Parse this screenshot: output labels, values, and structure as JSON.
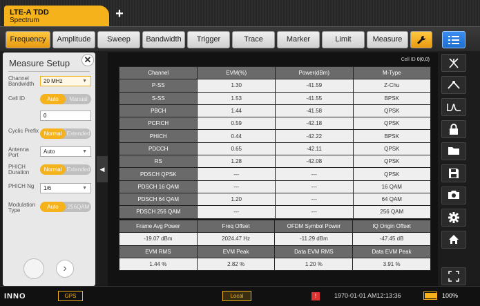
{
  "window": {
    "mode_tab": {
      "title": "LTE-A TDD",
      "subtitle": "Spectrum"
    },
    "add_tab_glyph": "+"
  },
  "menubar": {
    "items": [
      "Frequency",
      "Amplitude",
      "Sweep",
      "Bandwidth",
      "Trigger",
      "Trace",
      "Marker",
      "Limit",
      "Measure"
    ],
    "selected": "Frequency"
  },
  "panel": {
    "title": "Measure Setup",
    "close_glyph": "✕",
    "fields": {
      "channel_bandwidth": {
        "label": "Channel Bandwidth",
        "value": "20 MHz"
      },
      "cell_id": {
        "label": "Cell ID",
        "on": "Auto",
        "off": "Manual",
        "value": "0"
      },
      "cyclic_prefix": {
        "label": "Cyclic Prefix",
        "on": "Normal",
        "off": "Extended"
      },
      "antenna_port": {
        "label": "Antenna Port",
        "value": "Auto"
      },
      "phich_duration": {
        "label": "PHICH Duration",
        "on": "Normal",
        "off": "Extended"
      },
      "phich_ng": {
        "label": "PHICH Ng",
        "value": "1/6"
      },
      "modulation_type": {
        "label": "Modulation Type",
        "on": "Auto",
        "off": "256QAM"
      }
    },
    "next_glyph": "›"
  },
  "display": {
    "cell_id_label": "Cell ID",
    "cell_id_value": "0(0,0)",
    "channel_table": {
      "headers": [
        "Channel",
        "EVM(%)",
        "Power(dBm)",
        "M-Type"
      ],
      "rows": [
        [
          "P-SS",
          "1.30",
          "-41.59",
          "Z-Chu"
        ],
        [
          "S-SS",
          "1.53",
          "-41.55",
          "BPSK"
        ],
        [
          "PBCH",
          "1.44",
          "-41.58",
          "QPSK"
        ],
        [
          "PCFICH",
          "0.59",
          "-42.18",
          "QPSK"
        ],
        [
          "PHICH",
          "0.44",
          "-42.22",
          "BPSK"
        ],
        [
          "PDCCH",
          "0.65",
          "-42.11",
          "QPSK"
        ],
        [
          "RS",
          "1.28",
          "-42.08",
          "QPSK"
        ],
        [
          "PDSCH QPSK",
          "---",
          "---",
          "QPSK"
        ],
        [
          "PDSCH 16 QAM",
          "---",
          "---",
          "16 QAM"
        ],
        [
          "PDSCH 64 QAM",
          "1.20",
          "---",
          "64 QAM"
        ],
        [
          "PDSCH 256 QAM",
          "---",
          "---",
          "256 QAM"
        ]
      ]
    },
    "summary_table": {
      "row1_headers": [
        "Frame Avg Power",
        "Freq Offset",
        "OFDM Symbol Power",
        "IQ Origin Offset"
      ],
      "row1_values": [
        "-19.07 dBm",
        "2024.47 Hz",
        "-11.29 dBm",
        "-47.45 dB"
      ],
      "row2_headers": [
        "EVM RMS",
        "EVM Peak",
        "Data EVM RMS",
        "Data EVM Peak"
      ],
      "row2_values": [
        "1.44 %",
        "2.82 %",
        "1.20 %",
        "3.91 %"
      ]
    }
  },
  "sidebar": {
    "icons": [
      "antenna-icon",
      "peak-icon",
      "pulse-icon",
      "lock-icon",
      "folder-icon",
      "save-icon",
      "camera-icon",
      "gear-icon",
      "home-icon"
    ],
    "fullscreen_icon": "fullscreen-icon"
  },
  "statusbar": {
    "logo": "INNO",
    "gps": "GPS",
    "local": "Local",
    "datetime": "1970-01-01  AM12:13:36",
    "battery": "100%",
    "battery_level": 1.0
  },
  "colors": {
    "accent": "#f5b21b",
    "menu_blue": "#1e6fd0"
  }
}
